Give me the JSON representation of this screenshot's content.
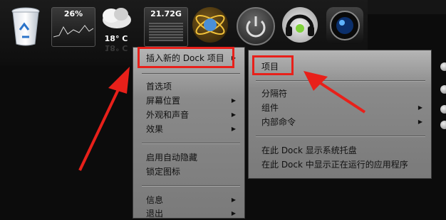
{
  "dock": {
    "cpu_widget": "26%",
    "weather_widget": {
      "temp": "18° C",
      "temp_reflection": "18° C"
    },
    "disk_widget": "21.72G",
    "icons": [
      "recycle-bin-icon",
      "cpu-meter-icon",
      "weather-icon",
      "disk-meter-icon",
      "globe-icon",
      "power-icon",
      "headphones-icon",
      "camera-lens-icon"
    ]
  },
  "main_menu": {
    "items": [
      {
        "label": "插入新的 Dock 项目",
        "submenu": true
      },
      {
        "label": "首选项",
        "submenu": false
      },
      {
        "label": "屏幕位置",
        "submenu": true
      },
      {
        "label": "外观和声音",
        "submenu": true
      },
      {
        "label": "效果",
        "submenu": true
      },
      {
        "label": "启用自动隐藏",
        "submenu": false
      },
      {
        "label": "锁定图标",
        "submenu": false
      },
      {
        "label": "信息",
        "submenu": true
      },
      {
        "label": "退出",
        "submenu": true
      }
    ]
  },
  "sub_menu": {
    "items": [
      {
        "label": "项目",
        "submenu": false
      },
      {
        "label": "分隔符",
        "submenu": false
      },
      {
        "label": "组件",
        "submenu": true
      },
      {
        "label": "内部命令",
        "submenu": true
      },
      {
        "label": "在此 Dock 显示系统托盘",
        "submenu": false
      },
      {
        "label": "在此 Dock 中显示正在运行的应用程序",
        "submenu": false
      }
    ]
  },
  "colors": {
    "highlight": "#e8201a",
    "menu_bg": "#7a7a7a",
    "dock_bg": "#151515"
  }
}
